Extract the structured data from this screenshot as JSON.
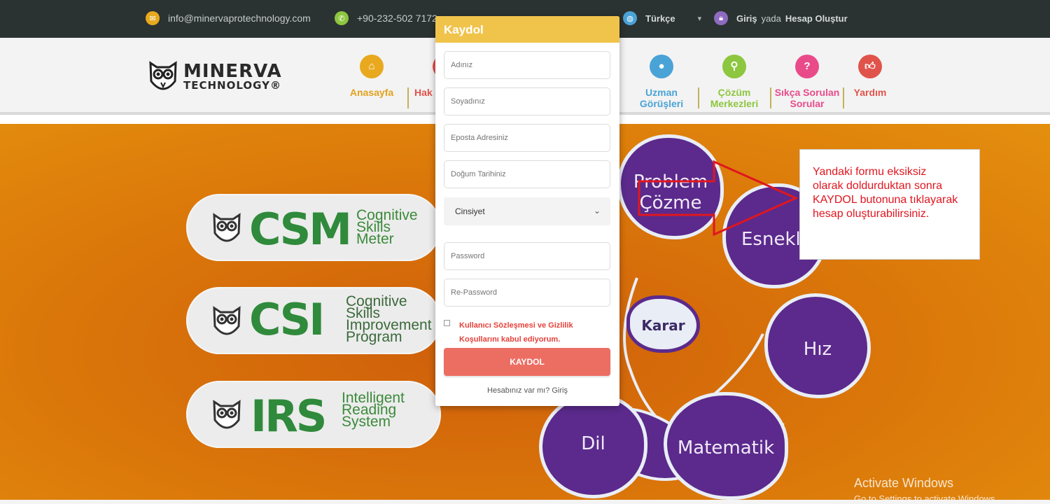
{
  "topbar": {
    "email": "info@minervaprotechnology.com",
    "phone": "+90-232-502 7172",
    "language": "Türkçe",
    "login": "Giriş",
    "or": "yada",
    "register": "Hesap Oluştur"
  },
  "logo": {
    "line1": "MINERVA",
    "line2": "TECHNOLOGY®"
  },
  "nav": {
    "items": [
      {
        "label": "Anasayfa",
        "icon": "home-icon",
        "color": "#e8a91e"
      },
      {
        "label": "Hak",
        "icon": "info-icon",
        "color": "#e0534b"
      },
      {
        "label": "Uzman Görüşleri",
        "icon": "user-icon",
        "color": "#4aa3d6"
      },
      {
        "label": "Çözüm Merkezleri",
        "icon": "map-pin-icon",
        "color": "#8dc63f"
      },
      {
        "label": "Sıkça Sorulan Sorular",
        "icon": "question-icon",
        "color": "#e94b8a"
      },
      {
        "label": "Yardım",
        "icon": "thumbs-up-icon",
        "color": "#e0534b"
      }
    ]
  },
  "hero": {
    "products": [
      {
        "abbr": "CSM",
        "full": [
          "Cognitive",
          "Skills",
          "Meter"
        ],
        "abbr_color": "#2f8a3b",
        "full_color": "#3b8a3b"
      },
      {
        "abbr": "CSI",
        "full": [
          "Cognitive",
          "Skills",
          "Improvement",
          "Program"
        ],
        "abbr_color": "#2f8a3b",
        "full_color": "#3b6a3b"
      },
      {
        "abbr": "IRS",
        "full": [
          "Intelligent",
          "Reading",
          "System"
        ],
        "abbr_color": "#2f8a3b",
        "full_color": "#3b8a3b"
      }
    ],
    "bubbles": [
      "Problem Çözme",
      "Esnekli",
      "Karar",
      "Hız",
      "Dil",
      "Matematik"
    ]
  },
  "modal": {
    "title": "Kaydol",
    "fields": {
      "name": "Adınız",
      "surname": "Soyadınız",
      "email": "Eposta Adresiniz",
      "birthdate": "Doğum Tarihiniz",
      "gender": "Cinsiyet",
      "password": "Password",
      "repassword": "Re-Password"
    },
    "agreement": [
      "Kullanıcı Sözleşmesi ve Gizlilik",
      "Koşullarını kabul ediyorum."
    ],
    "submit": "KAYDOL",
    "login_link": "Hesabınız var mı? Giriş"
  },
  "annotation": {
    "lines": [
      "Yandaki formu eksiksiz",
      "olarak doldurduktan sonra",
      "KAYDOL butonuna tıklayarak",
      "hesap oluşturabilirsiniz."
    ],
    "color": "#e0161f"
  },
  "watermark": {
    "line1": "Activate Windows",
    "line2": "Go to Settings to activate Windows."
  }
}
